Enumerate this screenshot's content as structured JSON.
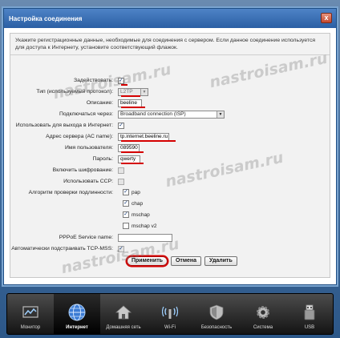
{
  "dialog": {
    "title": "Настройка соединения",
    "close_glyph": "x",
    "notice": "Укажите регистрационные данные, необходимые для соединения с сервером. Если данное соединение используется для доступа к Интернету, установите соответствующий флажок."
  },
  "form": {
    "enable_label": "Задействовать:",
    "protocol_label": "Тип (используемый протокол):",
    "protocol_value": "L2TP",
    "description_label": "Описание:",
    "description_value": "beeline",
    "connect_via_label": "Подключаться через:",
    "connect_via_value": "Broadband connection (ISP)",
    "use_internet_label": "Использовать для выхода в Интернет:",
    "server_label": "Адрес сервера (AC name):",
    "server_value": "tp.internet.beeline.ru",
    "username_label": "Имя пользователя:",
    "username_value": "089590",
    "password_label": "Пароль:",
    "password_value": "qwerty",
    "encryption_label": "Включить шифрование:",
    "ccp_label": "Использовать CCP:",
    "auth_label": "Алгоритм проверки подлинности:",
    "auth_options": [
      "pap",
      "chap",
      "mschap",
      "mschap v2"
    ],
    "pppoe_label": "PPPoE Service name:",
    "tcp_mss_label": "Автоматически подстраивать TCP-MSS:",
    "check_glyph": "✓",
    "arrow_glyph": "▼"
  },
  "buttons": {
    "apply": "Применить",
    "cancel": "Отмена",
    "delete": "Удалить"
  },
  "watermark": "nastroisam.ru",
  "taskbar": [
    {
      "label": "Монитор",
      "icon": "monitor-icon"
    },
    {
      "label": "Интернет",
      "icon": "globe-icon"
    },
    {
      "label": "Домашняя сеть",
      "icon": "home-icon"
    },
    {
      "label": "Wi-Fi",
      "icon": "wifi-icon"
    },
    {
      "label": "Безопасность",
      "icon": "shield-icon"
    },
    {
      "label": "Система",
      "icon": "gear-icon"
    },
    {
      "label": "USB",
      "icon": "usb-icon"
    }
  ],
  "colors": {
    "accent": "#2b5fa4",
    "highlight": "#d40000"
  }
}
